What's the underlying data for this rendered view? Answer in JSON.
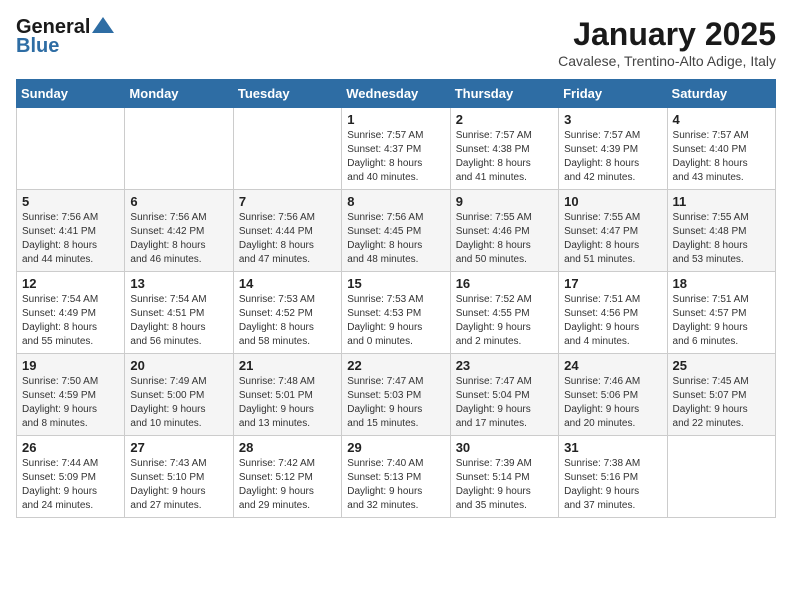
{
  "header": {
    "logo_general": "General",
    "logo_blue": "Blue",
    "month_title": "January 2025",
    "subtitle": "Cavalese, Trentino-Alto Adige, Italy"
  },
  "weekdays": [
    "Sunday",
    "Monday",
    "Tuesday",
    "Wednesday",
    "Thursday",
    "Friday",
    "Saturday"
  ],
  "weeks": [
    [
      {
        "day": "",
        "info": ""
      },
      {
        "day": "",
        "info": ""
      },
      {
        "day": "",
        "info": ""
      },
      {
        "day": "1",
        "info": "Sunrise: 7:57 AM\nSunset: 4:37 PM\nDaylight: 8 hours\nand 40 minutes."
      },
      {
        "day": "2",
        "info": "Sunrise: 7:57 AM\nSunset: 4:38 PM\nDaylight: 8 hours\nand 41 minutes."
      },
      {
        "day": "3",
        "info": "Sunrise: 7:57 AM\nSunset: 4:39 PM\nDaylight: 8 hours\nand 42 minutes."
      },
      {
        "day": "4",
        "info": "Sunrise: 7:57 AM\nSunset: 4:40 PM\nDaylight: 8 hours\nand 43 minutes."
      }
    ],
    [
      {
        "day": "5",
        "info": "Sunrise: 7:56 AM\nSunset: 4:41 PM\nDaylight: 8 hours\nand 44 minutes."
      },
      {
        "day": "6",
        "info": "Sunrise: 7:56 AM\nSunset: 4:42 PM\nDaylight: 8 hours\nand 46 minutes."
      },
      {
        "day": "7",
        "info": "Sunrise: 7:56 AM\nSunset: 4:44 PM\nDaylight: 8 hours\nand 47 minutes."
      },
      {
        "day": "8",
        "info": "Sunrise: 7:56 AM\nSunset: 4:45 PM\nDaylight: 8 hours\nand 48 minutes."
      },
      {
        "day": "9",
        "info": "Sunrise: 7:55 AM\nSunset: 4:46 PM\nDaylight: 8 hours\nand 50 minutes."
      },
      {
        "day": "10",
        "info": "Sunrise: 7:55 AM\nSunset: 4:47 PM\nDaylight: 8 hours\nand 51 minutes."
      },
      {
        "day": "11",
        "info": "Sunrise: 7:55 AM\nSunset: 4:48 PM\nDaylight: 8 hours\nand 53 minutes."
      }
    ],
    [
      {
        "day": "12",
        "info": "Sunrise: 7:54 AM\nSunset: 4:49 PM\nDaylight: 8 hours\nand 55 minutes."
      },
      {
        "day": "13",
        "info": "Sunrise: 7:54 AM\nSunset: 4:51 PM\nDaylight: 8 hours\nand 56 minutes."
      },
      {
        "day": "14",
        "info": "Sunrise: 7:53 AM\nSunset: 4:52 PM\nDaylight: 8 hours\nand 58 minutes."
      },
      {
        "day": "15",
        "info": "Sunrise: 7:53 AM\nSunset: 4:53 PM\nDaylight: 9 hours\nand 0 minutes."
      },
      {
        "day": "16",
        "info": "Sunrise: 7:52 AM\nSunset: 4:55 PM\nDaylight: 9 hours\nand 2 minutes."
      },
      {
        "day": "17",
        "info": "Sunrise: 7:51 AM\nSunset: 4:56 PM\nDaylight: 9 hours\nand 4 minutes."
      },
      {
        "day": "18",
        "info": "Sunrise: 7:51 AM\nSunset: 4:57 PM\nDaylight: 9 hours\nand 6 minutes."
      }
    ],
    [
      {
        "day": "19",
        "info": "Sunrise: 7:50 AM\nSunset: 4:59 PM\nDaylight: 9 hours\nand 8 minutes."
      },
      {
        "day": "20",
        "info": "Sunrise: 7:49 AM\nSunset: 5:00 PM\nDaylight: 9 hours\nand 10 minutes."
      },
      {
        "day": "21",
        "info": "Sunrise: 7:48 AM\nSunset: 5:01 PM\nDaylight: 9 hours\nand 13 minutes."
      },
      {
        "day": "22",
        "info": "Sunrise: 7:47 AM\nSunset: 5:03 PM\nDaylight: 9 hours\nand 15 minutes."
      },
      {
        "day": "23",
        "info": "Sunrise: 7:47 AM\nSunset: 5:04 PM\nDaylight: 9 hours\nand 17 minutes."
      },
      {
        "day": "24",
        "info": "Sunrise: 7:46 AM\nSunset: 5:06 PM\nDaylight: 9 hours\nand 20 minutes."
      },
      {
        "day": "25",
        "info": "Sunrise: 7:45 AM\nSunset: 5:07 PM\nDaylight: 9 hours\nand 22 minutes."
      }
    ],
    [
      {
        "day": "26",
        "info": "Sunrise: 7:44 AM\nSunset: 5:09 PM\nDaylight: 9 hours\nand 24 minutes."
      },
      {
        "day": "27",
        "info": "Sunrise: 7:43 AM\nSunset: 5:10 PM\nDaylight: 9 hours\nand 27 minutes."
      },
      {
        "day": "28",
        "info": "Sunrise: 7:42 AM\nSunset: 5:12 PM\nDaylight: 9 hours\nand 29 minutes."
      },
      {
        "day": "29",
        "info": "Sunrise: 7:40 AM\nSunset: 5:13 PM\nDaylight: 9 hours\nand 32 minutes."
      },
      {
        "day": "30",
        "info": "Sunrise: 7:39 AM\nSunset: 5:14 PM\nDaylight: 9 hours\nand 35 minutes."
      },
      {
        "day": "31",
        "info": "Sunrise: 7:38 AM\nSunset: 5:16 PM\nDaylight: 9 hours\nand 37 minutes."
      },
      {
        "day": "",
        "info": ""
      }
    ]
  ]
}
